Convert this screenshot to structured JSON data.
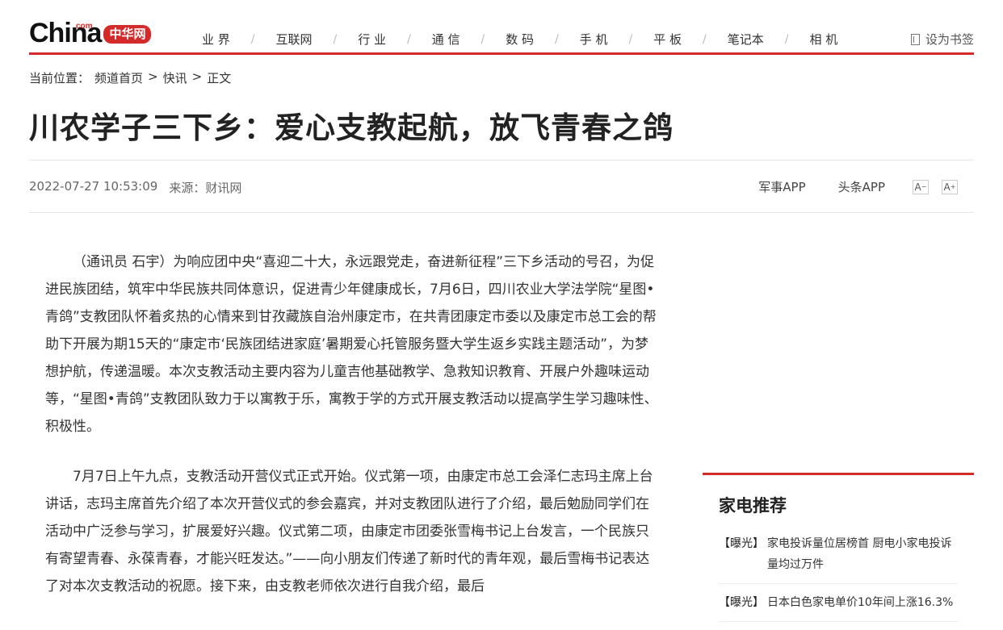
{
  "header": {
    "logo_text": "China",
    "logo_com": "com",
    "logo_badge": "中华网",
    "nav": [
      "业 界",
      "互联网",
      "行 业",
      "通 信",
      "数 码",
      "手 机",
      "平 板",
      "笔记本",
      "相 机"
    ],
    "nav_separator": "/",
    "bookmark_label": "设为书签"
  },
  "breadcrumb": {
    "prefix": "当前位置：",
    "items": [
      "频道首页",
      "快讯",
      "正文"
    ],
    "separator": ">"
  },
  "article": {
    "title": "川农学子三下乡：爱心支教起航，放飞青春之鸽",
    "datetime": "2022-07-27 10:53:09",
    "source": "来源：财讯网",
    "paragraphs": [
      "（通讯员 石宇）为响应团中央“喜迎二十大，永远跟党走，奋进新征程”三下乡活动的号召，为促进民族团结，筑牢中华民族共同体意识，促进青少年健康成长，7月6日，四川农业大学法学院“星图•青鸽”支教团队怀着炙热的心情来到甘孜藏族自治州康定市，在共青团康定市委以及康定市总工会的帮助下开展为期15天的“康定市‘民族团结进家庭’暑期爱心托管服务暨大学生返乡实践主题活动”，为梦想护航，传递温暖。本次支教活动主要内容为儿童吉他基础教学、急救知识教育、开展户外趣味运动等，“星图•青鸽”支教团队致力于以寓教于乐，寓教于学的方式开展支教活动以提高学生学习趣味性、积极性。",
      "7月7日上午九点，支教活动开营仪式正式开始。仪式第一项，由康定市总工会泽仁志玛主席上台讲话，志玛主席首先介绍了本次开营仪式的参会嘉宾，并对支教团队进行了介绍，最后勉励同学们在活动中广泛参与学习，扩展爱好兴趣。仪式第二项，由康定市团委张雪梅书记上台发言，一个民族只有寄望青春、永葆青春，才能兴旺发达。”——向小朋友们传递了新时代的青年观，最后雪梅书记表达了对本次支教活动的祝愿。接下来，由支教老师依次进行自我介绍，最后"
    ]
  },
  "meta_links": [
    "军事APP",
    "头条APP"
  ],
  "font_buttons": {
    "smaller": "A",
    "smaller_sup": "−",
    "larger": "A",
    "larger_sup": "+"
  },
  "sidebar": {
    "title": "家电推荐",
    "items": [
      {
        "tag": "【曝光】",
        "text": "家电投诉量位居榜首 厨电小家电投诉量均过万件"
      },
      {
        "tag": "【曝光】",
        "text": "日本白色家电单价10年间上涨16.3%"
      }
    ]
  },
  "colors": {
    "accent": "#d52a2a"
  }
}
